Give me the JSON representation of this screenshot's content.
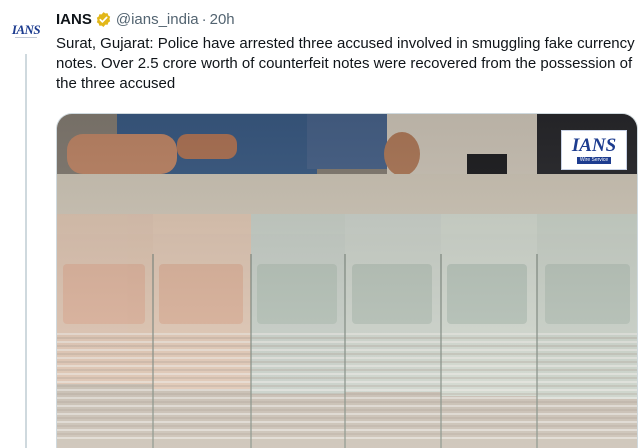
{
  "tweet": {
    "author_name": "IANS",
    "handle": "@ians_india",
    "separator": "·",
    "time": "20h",
    "text": "Surat, Gujarat: Police have arrested three accused involved in smuggling fake currency notes. Over 2.5 crore worth of counterfeit notes were recovered from the possession of the three accused",
    "verified_badge_color": "#e2b719",
    "avatar_logo_text": "IANS"
  },
  "media": {
    "watermark_logo": "IANS",
    "watermark_sub": "Wire Service",
    "accent": "#1d3c8f"
  }
}
